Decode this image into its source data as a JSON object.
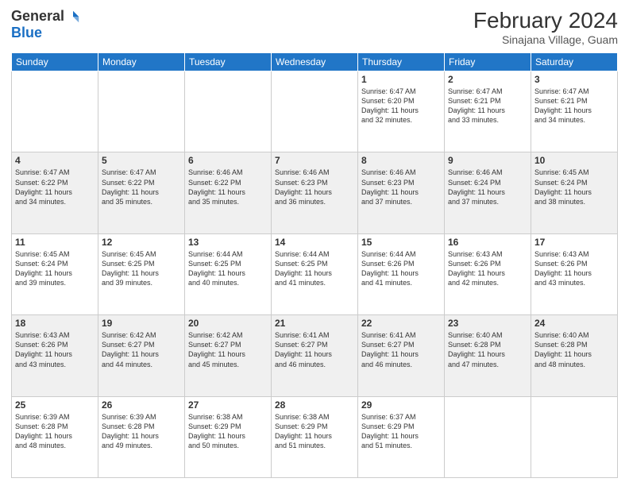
{
  "header": {
    "logo_general": "General",
    "logo_blue": "Blue",
    "month_year": "February 2024",
    "location": "Sinajana Village, Guam"
  },
  "weekdays": [
    "Sunday",
    "Monday",
    "Tuesday",
    "Wednesday",
    "Thursday",
    "Friday",
    "Saturday"
  ],
  "weeks": [
    [
      {
        "day": "",
        "info": ""
      },
      {
        "day": "",
        "info": ""
      },
      {
        "day": "",
        "info": ""
      },
      {
        "day": "",
        "info": ""
      },
      {
        "day": "1",
        "info": "Sunrise: 6:47 AM\nSunset: 6:20 PM\nDaylight: 11 hours\nand 32 minutes."
      },
      {
        "day": "2",
        "info": "Sunrise: 6:47 AM\nSunset: 6:21 PM\nDaylight: 11 hours\nand 33 minutes."
      },
      {
        "day": "3",
        "info": "Sunrise: 6:47 AM\nSunset: 6:21 PM\nDaylight: 11 hours\nand 34 minutes."
      }
    ],
    [
      {
        "day": "4",
        "info": "Sunrise: 6:47 AM\nSunset: 6:22 PM\nDaylight: 11 hours\nand 34 minutes."
      },
      {
        "day": "5",
        "info": "Sunrise: 6:47 AM\nSunset: 6:22 PM\nDaylight: 11 hours\nand 35 minutes."
      },
      {
        "day": "6",
        "info": "Sunrise: 6:46 AM\nSunset: 6:22 PM\nDaylight: 11 hours\nand 35 minutes."
      },
      {
        "day": "7",
        "info": "Sunrise: 6:46 AM\nSunset: 6:23 PM\nDaylight: 11 hours\nand 36 minutes."
      },
      {
        "day": "8",
        "info": "Sunrise: 6:46 AM\nSunset: 6:23 PM\nDaylight: 11 hours\nand 37 minutes."
      },
      {
        "day": "9",
        "info": "Sunrise: 6:46 AM\nSunset: 6:24 PM\nDaylight: 11 hours\nand 37 minutes."
      },
      {
        "day": "10",
        "info": "Sunrise: 6:45 AM\nSunset: 6:24 PM\nDaylight: 11 hours\nand 38 minutes."
      }
    ],
    [
      {
        "day": "11",
        "info": "Sunrise: 6:45 AM\nSunset: 6:24 PM\nDaylight: 11 hours\nand 39 minutes."
      },
      {
        "day": "12",
        "info": "Sunrise: 6:45 AM\nSunset: 6:25 PM\nDaylight: 11 hours\nand 39 minutes."
      },
      {
        "day": "13",
        "info": "Sunrise: 6:44 AM\nSunset: 6:25 PM\nDaylight: 11 hours\nand 40 minutes."
      },
      {
        "day": "14",
        "info": "Sunrise: 6:44 AM\nSunset: 6:25 PM\nDaylight: 11 hours\nand 41 minutes."
      },
      {
        "day": "15",
        "info": "Sunrise: 6:44 AM\nSunset: 6:26 PM\nDaylight: 11 hours\nand 41 minutes."
      },
      {
        "day": "16",
        "info": "Sunrise: 6:43 AM\nSunset: 6:26 PM\nDaylight: 11 hours\nand 42 minutes."
      },
      {
        "day": "17",
        "info": "Sunrise: 6:43 AM\nSunset: 6:26 PM\nDaylight: 11 hours\nand 43 minutes."
      }
    ],
    [
      {
        "day": "18",
        "info": "Sunrise: 6:43 AM\nSunset: 6:26 PM\nDaylight: 11 hours\nand 43 minutes."
      },
      {
        "day": "19",
        "info": "Sunrise: 6:42 AM\nSunset: 6:27 PM\nDaylight: 11 hours\nand 44 minutes."
      },
      {
        "day": "20",
        "info": "Sunrise: 6:42 AM\nSunset: 6:27 PM\nDaylight: 11 hours\nand 45 minutes."
      },
      {
        "day": "21",
        "info": "Sunrise: 6:41 AM\nSunset: 6:27 PM\nDaylight: 11 hours\nand 46 minutes."
      },
      {
        "day": "22",
        "info": "Sunrise: 6:41 AM\nSunset: 6:27 PM\nDaylight: 11 hours\nand 46 minutes."
      },
      {
        "day": "23",
        "info": "Sunrise: 6:40 AM\nSunset: 6:28 PM\nDaylight: 11 hours\nand 47 minutes."
      },
      {
        "day": "24",
        "info": "Sunrise: 6:40 AM\nSunset: 6:28 PM\nDaylight: 11 hours\nand 48 minutes."
      }
    ],
    [
      {
        "day": "25",
        "info": "Sunrise: 6:39 AM\nSunset: 6:28 PM\nDaylight: 11 hours\nand 48 minutes."
      },
      {
        "day": "26",
        "info": "Sunrise: 6:39 AM\nSunset: 6:28 PM\nDaylight: 11 hours\nand 49 minutes."
      },
      {
        "day": "27",
        "info": "Sunrise: 6:38 AM\nSunset: 6:29 PM\nDaylight: 11 hours\nand 50 minutes."
      },
      {
        "day": "28",
        "info": "Sunrise: 6:38 AM\nSunset: 6:29 PM\nDaylight: 11 hours\nand 51 minutes."
      },
      {
        "day": "29",
        "info": "Sunrise: 6:37 AM\nSunset: 6:29 PM\nDaylight: 11 hours\nand 51 minutes."
      },
      {
        "day": "",
        "info": ""
      },
      {
        "day": "",
        "info": ""
      }
    ]
  ]
}
